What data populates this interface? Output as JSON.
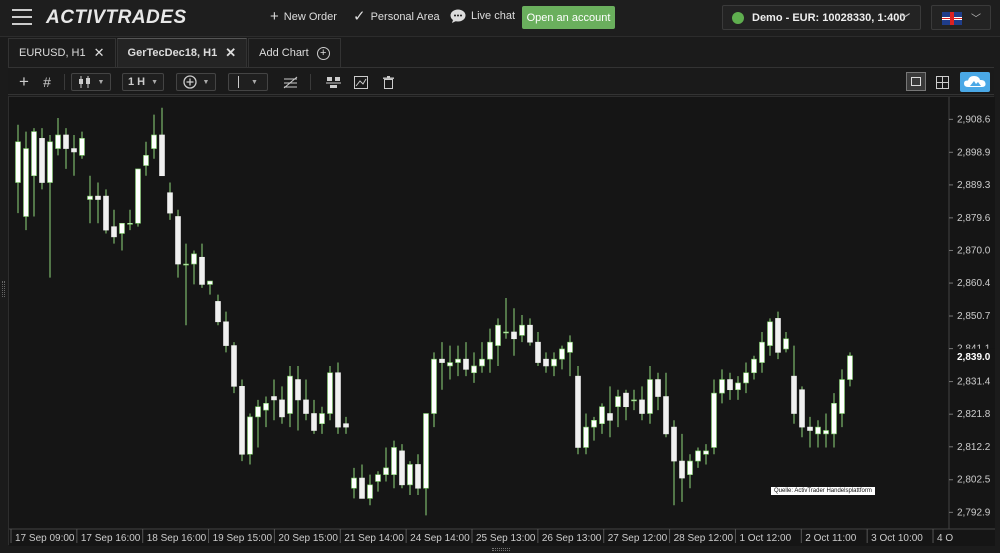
{
  "header": {
    "logo": "ACTIVTRADES",
    "new_order": "New Order",
    "personal_area": "Personal Area",
    "live_chat": "Live chat",
    "open_account": "Open an account",
    "account": "Demo - EUR: 10028330, 1:400"
  },
  "tabs": [
    {
      "label": "EURUSD, H1"
    },
    {
      "label": "GerTecDec18, H1"
    },
    {
      "label": "Add Chart"
    }
  ],
  "toolbar": {
    "timeframe": "1 H"
  },
  "colors": {
    "bull": "#ffffff",
    "bear": "#f0f0f0",
    "wick": "#8fd67a",
    "bull_border": "#7fcf6a",
    "background": "#151515",
    "axis_text": "#cccccc"
  },
  "chart_data": {
    "type": "candlestick",
    "ylim": [
      2788.0,
      2914.0
    ],
    "y_ticks": [
      "2,908.6",
      "2,898.9",
      "2,889.3",
      "2,879.6",
      "2,870.0",
      "2,860.4",
      "2,850.7",
      "2,841.1",
      "2,831.4",
      "2,821.8",
      "2,812.2",
      "2,802.5",
      "2,792.9"
    ],
    "y_tick_values": [
      2908.6,
      2898.9,
      2889.3,
      2879.6,
      2870.0,
      2860.4,
      2850.7,
      2841.1,
      2831.4,
      2821.8,
      2812.2,
      2802.5,
      2792.9
    ],
    "current_price": "2,839.0",
    "current_value": 2839.0,
    "x_labels": [
      "17 Sep 09:00",
      "17 Sep 16:00",
      "18 Sep 16:00",
      "19 Sep 15:00",
      "20 Sep 15:00",
      "21 Sep 14:00",
      "24 Sep 14:00",
      "25 Sep 13:00",
      "26 Sep 13:00",
      "27 Sep 12:00",
      "28 Sep 12:00",
      "1 Oct 12:00",
      "2 Oct 11:00",
      "3 Oct 10:00",
      "4 O"
    ],
    "source_note": "Quelle: ActivTrader Handelsplattform",
    "candles": [
      {
        "o": 2890,
        "h": 2907,
        "l": 2881,
        "c": 2902
      },
      {
        "o": 2880,
        "h": 2905,
        "l": 2876,
        "c": 2900
      },
      {
        "o": 2892,
        "h": 2906,
        "l": 2880,
        "c": 2905
      },
      {
        "o": 2903,
        "h": 2906,
        "l": 2888,
        "c": 2890
      },
      {
        "o": 2890,
        "h": 2904,
        "l": 2862,
        "c": 2902
      },
      {
        "o": 2900,
        "h": 2909,
        "l": 2898,
        "c": 2904
      },
      {
        "o": 2904,
        "h": 2906,
        "l": 2894,
        "c": 2900
      },
      {
        "o": 2900,
        "h": 2904,
        "l": 2892,
        "c": 2899
      },
      {
        "o": 2898,
        "h": 2905,
        "l": 2897,
        "c": 2903
      },
      {
        "o": 2885,
        "h": 2892,
        "l": 2878,
        "c": 2886
      },
      {
        "o": 2886,
        "h": 2890,
        "l": 2878,
        "c": 2885
      },
      {
        "o": 2886,
        "h": 2888,
        "l": 2875,
        "c": 2876
      },
      {
        "o": 2877,
        "h": 2882,
        "l": 2872,
        "c": 2874
      },
      {
        "o": 2875,
        "h": 2878,
        "l": 2870,
        "c": 2878
      },
      {
        "o": 2878,
        "h": 2882,
        "l": 2876,
        "c": 2878
      },
      {
        "o": 2878,
        "h": 2894,
        "l": 2877,
        "c": 2894
      },
      {
        "o": 2895,
        "h": 2902,
        "l": 2892,
        "c": 2898
      },
      {
        "o": 2900,
        "h": 2910,
        "l": 2897,
        "c": 2904
      },
      {
        "o": 2904,
        "h": 2912,
        "l": 2892,
        "c": 2892
      },
      {
        "o": 2887,
        "h": 2890,
        "l": 2879,
        "c": 2881
      },
      {
        "o": 2880,
        "h": 2882,
        "l": 2862,
        "c": 2866
      },
      {
        "o": 2866,
        "h": 2872,
        "l": 2848,
        "c": 2866
      },
      {
        "o": 2866,
        "h": 2870,
        "l": 2860,
        "c": 2869
      },
      {
        "o": 2868,
        "h": 2872,
        "l": 2859,
        "c": 2860
      },
      {
        "o": 2860,
        "h": 2861,
        "l": 2857,
        "c": 2861
      },
      {
        "o": 2855,
        "h": 2857,
        "l": 2848,
        "c": 2849
      },
      {
        "o": 2849,
        "h": 2852,
        "l": 2840,
        "c": 2842
      },
      {
        "o": 2842,
        "h": 2843,
        "l": 2828,
        "c": 2830
      },
      {
        "o": 2830,
        "h": 2832,
        "l": 2808,
        "c": 2810
      },
      {
        "o": 2810,
        "h": 2822,
        "l": 2807,
        "c": 2821
      },
      {
        "o": 2821,
        "h": 2826,
        "l": 2812,
        "c": 2824
      },
      {
        "o": 2823,
        "h": 2827,
        "l": 2818,
        "c": 2825
      },
      {
        "o": 2827,
        "h": 2832,
        "l": 2820,
        "c": 2826
      },
      {
        "o": 2826,
        "h": 2830,
        "l": 2819,
        "c": 2821
      },
      {
        "o": 2822,
        "h": 2836,
        "l": 2818,
        "c": 2833
      },
      {
        "o": 2832,
        "h": 2836,
        "l": 2817,
        "c": 2826
      },
      {
        "o": 2826,
        "h": 2832,
        "l": 2820,
        "c": 2822
      },
      {
        "o": 2822,
        "h": 2826,
        "l": 2816,
        "c": 2817
      },
      {
        "o": 2819,
        "h": 2824,
        "l": 2816,
        "c": 2822
      },
      {
        "o": 2822,
        "h": 2836,
        "l": 2820,
        "c": 2834
      },
      {
        "o": 2834,
        "h": 2837,
        "l": 2816,
        "c": 2818
      },
      {
        "o": 2819,
        "h": 2821,
        "l": 2816,
        "c": 2818
      },
      {
        "o": 2800,
        "h": 2806,
        "l": 2797,
        "c": 2803
      },
      {
        "o": 2803,
        "h": 2807,
        "l": 2797,
        "c": 2797
      },
      {
        "o": 2797,
        "h": 2804,
        "l": 2795,
        "c": 2801
      },
      {
        "o": 2802,
        "h": 2805,
        "l": 2799,
        "c": 2804
      },
      {
        "o": 2804,
        "h": 2812,
        "l": 2802,
        "c": 2806
      },
      {
        "o": 2804,
        "h": 2814,
        "l": 2800,
        "c": 2812
      },
      {
        "o": 2811,
        "h": 2813,
        "l": 2800,
        "c": 2801
      },
      {
        "o": 2801,
        "h": 2808,
        "l": 2798,
        "c": 2807
      },
      {
        "o": 2807,
        "h": 2810,
        "l": 2798,
        "c": 2800
      },
      {
        "o": 2800,
        "h": 2822,
        "l": 2792,
        "c": 2822
      },
      {
        "o": 2822,
        "h": 2840,
        "l": 2818,
        "c": 2838
      },
      {
        "o": 2838,
        "h": 2843,
        "l": 2829,
        "c": 2837
      },
      {
        "o": 2836,
        "h": 2842,
        "l": 2832,
        "c": 2837
      },
      {
        "o": 2837,
        "h": 2842,
        "l": 2833,
        "c": 2838
      },
      {
        "o": 2838,
        "h": 2843,
        "l": 2833,
        "c": 2835
      },
      {
        "o": 2834,
        "h": 2840,
        "l": 2831,
        "c": 2836
      },
      {
        "o": 2836,
        "h": 2843,
        "l": 2834,
        "c": 2838
      },
      {
        "o": 2838,
        "h": 2847,
        "l": 2834,
        "c": 2843
      },
      {
        "o": 2842,
        "h": 2850,
        "l": 2836,
        "c": 2848
      },
      {
        "o": 2846,
        "h": 2856,
        "l": 2844,
        "c": 2846
      },
      {
        "o": 2846,
        "h": 2853,
        "l": 2839,
        "c": 2844
      },
      {
        "o": 2845,
        "h": 2851,
        "l": 2843,
        "c": 2848
      },
      {
        "o": 2848,
        "h": 2850,
        "l": 2842,
        "c": 2843
      },
      {
        "o": 2843,
        "h": 2846,
        "l": 2836,
        "c": 2837
      },
      {
        "o": 2838,
        "h": 2840,
        "l": 2834,
        "c": 2836
      },
      {
        "o": 2836,
        "h": 2840,
        "l": 2833,
        "c": 2838
      },
      {
        "o": 2838,
        "h": 2842,
        "l": 2835,
        "c": 2841
      },
      {
        "o": 2840,
        "h": 2845,
        "l": 2833,
        "c": 2843
      },
      {
        "o": 2833,
        "h": 2836,
        "l": 2810,
        "c": 2812
      },
      {
        "o": 2812,
        "h": 2822,
        "l": 2810,
        "c": 2818
      },
      {
        "o": 2818,
        "h": 2821,
        "l": 2814,
        "c": 2820
      },
      {
        "o": 2819,
        "h": 2825,
        "l": 2816,
        "c": 2824
      },
      {
        "o": 2822,
        "h": 2830,
        "l": 2815,
        "c": 2820
      },
      {
        "o": 2824,
        "h": 2829,
        "l": 2818,
        "c": 2827
      },
      {
        "o": 2828,
        "h": 2829,
        "l": 2820,
        "c": 2824
      },
      {
        "o": 2826,
        "h": 2829,
        "l": 2823,
        "c": 2826
      },
      {
        "o": 2826,
        "h": 2830,
        "l": 2820,
        "c": 2822
      },
      {
        "o": 2822,
        "h": 2836,
        "l": 2819,
        "c": 2832
      },
      {
        "o": 2832,
        "h": 2834,
        "l": 2823,
        "c": 2827
      },
      {
        "o": 2827,
        "h": 2834,
        "l": 2815,
        "c": 2816
      },
      {
        "o": 2818,
        "h": 2820,
        "l": 2795,
        "c": 2808
      },
      {
        "o": 2808,
        "h": 2816,
        "l": 2796,
        "c": 2803
      },
      {
        "o": 2804,
        "h": 2810,
        "l": 2800,
        "c": 2808
      },
      {
        "o": 2808,
        "h": 2812,
        "l": 2806,
        "c": 2811
      },
      {
        "o": 2810,
        "h": 2813,
        "l": 2807,
        "c": 2811
      },
      {
        "o": 2812,
        "h": 2832,
        "l": 2810,
        "c": 2828
      },
      {
        "o": 2828,
        "h": 2835,
        "l": 2825,
        "c": 2832
      },
      {
        "o": 2832,
        "h": 2834,
        "l": 2826,
        "c": 2829
      },
      {
        "o": 2829,
        "h": 2833,
        "l": 2826,
        "c": 2831
      },
      {
        "o": 2831,
        "h": 2837,
        "l": 2828,
        "c": 2834
      },
      {
        "o": 2834,
        "h": 2839,
        "l": 2832,
        "c": 2838
      },
      {
        "o": 2837,
        "h": 2846,
        "l": 2834,
        "c": 2843
      },
      {
        "o": 2842,
        "h": 2850,
        "l": 2839,
        "c": 2849
      },
      {
        "o": 2850,
        "h": 2852,
        "l": 2838,
        "c": 2840
      },
      {
        "o": 2841,
        "h": 2846,
        "l": 2840,
        "c": 2844
      },
      {
        "o": 2833,
        "h": 2842,
        "l": 2819,
        "c": 2822
      },
      {
        "o": 2829,
        "h": 2830,
        "l": 2815,
        "c": 2818
      },
      {
        "o": 2818,
        "h": 2821,
        "l": 2812,
        "c": 2817
      },
      {
        "o": 2816,
        "h": 2820,
        "l": 2812,
        "c": 2818
      },
      {
        "o": 2816,
        "h": 2822,
        "l": 2812,
        "c": 2817
      },
      {
        "o": 2816,
        "h": 2828,
        "l": 2812,
        "c": 2825
      },
      {
        "o": 2822,
        "h": 2835,
        "l": 2818,
        "c": 2832
      },
      {
        "o": 2832,
        "h": 2840,
        "l": 2830,
        "c": 2839
      }
    ]
  }
}
